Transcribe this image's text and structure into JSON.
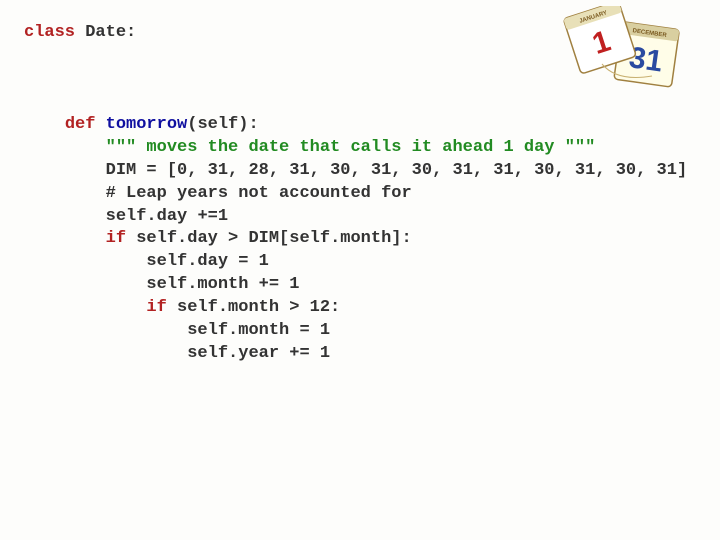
{
  "code": {
    "l1_kw": "class ",
    "l1_name": "Date",
    "l1_tail": ":",
    "l2_kw": "def ",
    "l2_name": "tomorrow",
    "l2_tail": "(self):",
    "l3": "\"\"\" moves the date that calls it ahead 1 day \"\"\"",
    "l4_a": "DIM = [",
    "l4_b": "0, 31, 28, 31, 30, 31, 30, 31, 31, 30, 31, 30, 31",
    "l4_c": "]",
    "l5": "# Leap years not accounted for",
    "l6": "self.day +=1",
    "l7_a": "if ",
    "l7_b": "self.day > DIM[self.month]:",
    "l8": "self.day = 1",
    "l9": "self.month += 1",
    "l10_a": "if ",
    "l10_b": "self.month > 12:",
    "l11": "self.month = 1",
    "l12": "self.year += 1"
  },
  "indent": {
    "i0": "",
    "i1": "    ",
    "i2": "        ",
    "i3": "            ",
    "i4": "                ",
    "i5": "                    "
  },
  "calendar": {
    "day_front": "1",
    "month_front": "JANUARY",
    "day_back": "31",
    "month_back": "DECEMBER"
  }
}
